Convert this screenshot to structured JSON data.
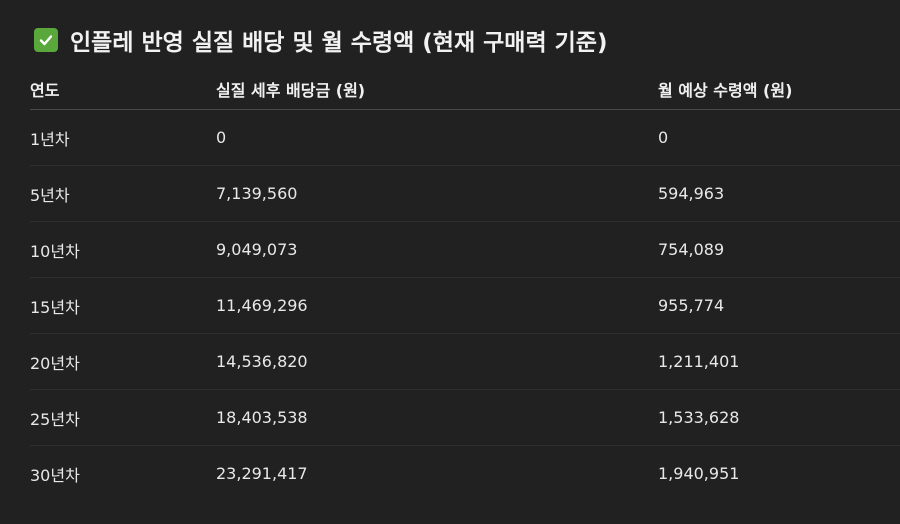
{
  "heading": {
    "icon": "check-mark-button-icon",
    "text": "인플레 반영 실질 배당 및 월 수령액 (현재 구매력 기준)"
  },
  "table": {
    "headers": [
      "연도",
      "실질 세후 배당금 (원)",
      "월 예상 수령액 (원)"
    ],
    "rows": [
      [
        "1년차",
        "0",
        "0"
      ],
      [
        "5년차",
        "7,139,560",
        "594,963"
      ],
      [
        "10년차",
        "9,049,073",
        "754,089"
      ],
      [
        "15년차",
        "11,469,296",
        "955,774"
      ],
      [
        "20년차",
        "14,536,820",
        "1,211,401"
      ],
      [
        "25년차",
        "18,403,538",
        "1,533,628"
      ],
      [
        "30년차",
        "23,291,417",
        "1,940,951"
      ]
    ]
  },
  "colors": {
    "background": "#212121",
    "check_icon": "#5aa83c",
    "text": "#ececec"
  }
}
